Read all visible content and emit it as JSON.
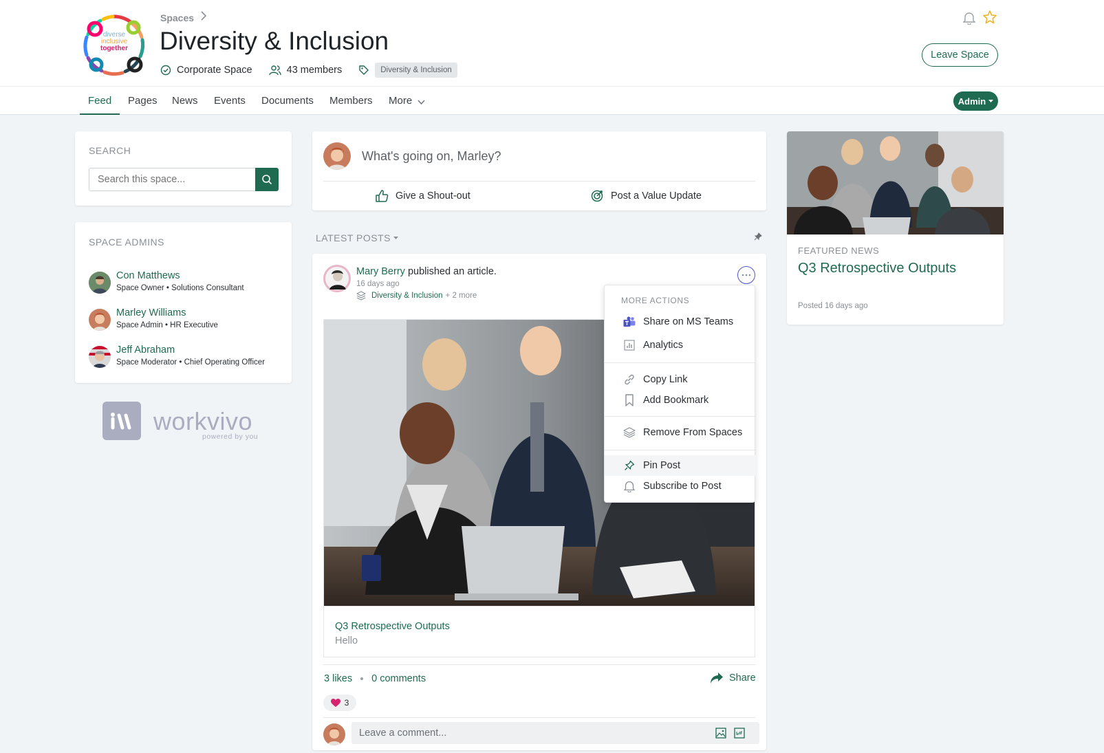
{
  "breadcrumb": {
    "parent": "Spaces"
  },
  "space": {
    "logo_lines": [
      "diverse",
      "inclusive",
      "together"
    ],
    "title": "Diversity & Inclusion",
    "type": "Corporate Space",
    "members": "43 members",
    "tag": "Diversity & Inclusion"
  },
  "header_actions": {
    "leave": "Leave Space"
  },
  "tabs": [
    "Feed",
    "Pages",
    "News",
    "Events",
    "Documents",
    "Members",
    "More"
  ],
  "admin_button": "Admin",
  "search": {
    "title": "SEARCH",
    "placeholder": "Search this space..."
  },
  "admins": {
    "title": "SPACE ADMINS",
    "people": [
      {
        "name": "Con Matthews",
        "role": "Space Owner • Solutions Consultant"
      },
      {
        "name": "Marley Williams",
        "role": "Space Admin • HR Executive"
      },
      {
        "name": "Jeff Abraham",
        "role": "Space Moderator • Chief Operating Officer"
      }
    ]
  },
  "brand": {
    "name": "workvivo",
    "tagline": "powered by you"
  },
  "composer": {
    "placeholder": "What's going on, Marley?",
    "shoutout": "Give a Shout-out",
    "value_update": "Post a Value Update"
  },
  "feed": {
    "filter": "LATEST POSTS"
  },
  "post": {
    "author": "Mary Berry",
    "action": "published an article.",
    "time": "16 days ago",
    "space": "Diversity & Inclusion",
    "more_spaces": "+ 2 more",
    "article_title": "Q3 Retrospective Outputs",
    "article_excerpt": "Hello",
    "likes": "3 likes",
    "comments": "0 comments",
    "share": "Share",
    "reaction_count": "3",
    "comment_placeholder": "Leave a comment..."
  },
  "menu": {
    "title": "MORE ACTIONS",
    "items": [
      "Share on MS Teams",
      "Analytics",
      "Copy Link",
      "Add Bookmark",
      "Remove From Spaces",
      "Pin Post",
      "Subscribe to Post"
    ]
  },
  "featured": {
    "label": "FEATURED NEWS",
    "title": "Q3 Retrospective Outputs",
    "posted": "Posted 16 days ago"
  },
  "colors": {
    "accent": "#1f6b52",
    "heart": "#d6246e",
    "teams": "#5059c9"
  }
}
